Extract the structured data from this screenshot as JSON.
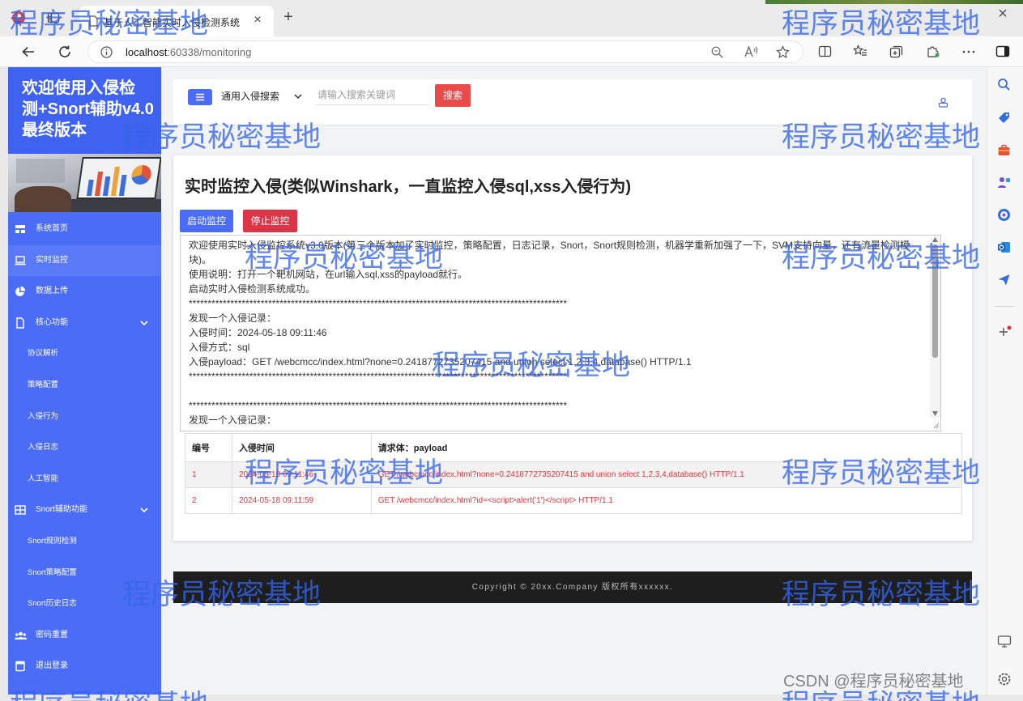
{
  "browser": {
    "tab_title": "基于人工智能实时入侵检测系统",
    "new_tab_label": "+",
    "window_close_label": "×",
    "tab_close_label": "×",
    "url_host": "localhost",
    "url_rest": ":60338/monitoring"
  },
  "sidebar": {
    "title_lines": [
      "欢迎使用入侵检",
      "测+Snort辅助v4.0",
      "最终版本"
    ],
    "items": [
      {
        "label": "系统首页",
        "icon": "dashboard-icon"
      },
      {
        "label": "实时监控",
        "icon": "monitor-icon",
        "active": true
      },
      {
        "label": "数据上传",
        "icon": "pie-chart-icon"
      },
      {
        "label": "核心功能",
        "icon": "document-icon",
        "expanded": true
      },
      {
        "label": "协议解析"
      },
      {
        "label": "策略配置"
      },
      {
        "label": "入侵行为"
      },
      {
        "label": "入侵日志"
      },
      {
        "label": "人工智能"
      },
      {
        "label": "Snort辅助功能",
        "icon": "table-icon",
        "expanded": true
      },
      {
        "label": "Snort规则检测"
      },
      {
        "label": "Snort策略配置"
      },
      {
        "label": "Snort历史日志"
      },
      {
        "label": "密码重置",
        "icon": "users-icon"
      },
      {
        "label": "退出登录",
        "icon": "logout-icon"
      }
    ]
  },
  "topbar": {
    "search_type": "通用入侵搜索",
    "search_placeholder": "请输入搜索关键词",
    "search_button": "搜索"
  },
  "monitor": {
    "title": "实时监控入侵(类似Winshark，一直监控入侵sql,xss入侵行为)",
    "start_button": "启动监控",
    "stop_button": "停止监控",
    "log_lines": [
      "欢迎使用实时入侵监控系统v3.0版本(第三个版本加了实时监控，策略配置，日志记录，Snort，Snort规则检测，机器学重新加强了一下，SVM支持向量，还有流量检测模块)。",
      "使用说明：打开一个靶机网站，在url输入sql,xss的payload就行。",
      "启动实时入侵检测系统成功。",
      "****************************************************************************************************",
      "发现一个入侵记录：",
      "入侵时间：2024-05-18 09:11:46",
      "入侵方式：sql",
      "入侵payload：GET /webcmcc/index.html?none=0.2418772735207415 and union select 1,2,3,4,database() HTTP/1.1",
      "****************************************************************************************************",
      "",
      "****************************************************************************************************",
      "发现一个入侵记录："
    ]
  },
  "intrusion_table": {
    "headers": [
      "编号",
      "入侵时间",
      "请求体：payload"
    ],
    "rows": [
      {
        "id": "1",
        "time": "2024-05-18 09:11:46",
        "payload": "GET /webcmcc/index.html?none=0.2418772735207415 and union select 1,2,3,4,database() HTTP/1.1"
      },
      {
        "id": "2",
        "time": "2024-05-18 09:11:59",
        "payload": "GET /webcmcc/index.html?id=<script>alert('1')</script> HTTP/1.1"
      }
    ]
  },
  "footer": {
    "copyright": "Copyright © 20xx.Company 版权所有xxxxxx."
  },
  "watermark": {
    "text": "程序员秘密基地",
    "csdn": "CSDN @程序员秘密基地"
  },
  "colors": {
    "sidebar_blue": "#4b6cf6",
    "primary_blue": "#4b6cf6",
    "danger_red": "#dc3545",
    "search_red": "#e94b4b",
    "payload_red": "#e8333a",
    "footer_dark": "#1e1e1e",
    "watermark_blue": "#3464e8"
  }
}
